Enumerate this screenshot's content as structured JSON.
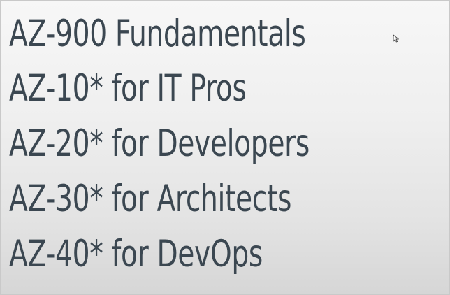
{
  "slide": {
    "lines": [
      "AZ-900 Fundamentals",
      "AZ-10* for IT Pros",
      "AZ-20* for Developers",
      "AZ-30* for Architects",
      "AZ-40* for DevOps"
    ]
  },
  "colors": {
    "text": "#3b4751",
    "background": "#efefef"
  },
  "icons": {
    "cursor": "mouse-pointer-icon"
  }
}
